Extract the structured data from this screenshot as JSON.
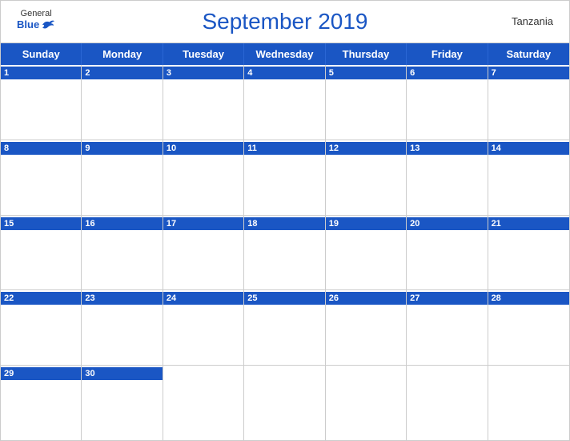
{
  "header": {
    "title": "September 2019",
    "country": "Tanzania",
    "logo": {
      "general": "General",
      "blue": "Blue"
    }
  },
  "days_of_week": [
    "Sunday",
    "Monday",
    "Tuesday",
    "Wednesday",
    "Thursday",
    "Friday",
    "Saturday"
  ],
  "weeks": [
    [
      1,
      2,
      3,
      4,
      5,
      6,
      7
    ],
    [
      8,
      9,
      10,
      11,
      12,
      13,
      14
    ],
    [
      15,
      16,
      17,
      18,
      19,
      20,
      21
    ],
    [
      22,
      23,
      24,
      25,
      26,
      27,
      28
    ],
    [
      29,
      30,
      null,
      null,
      null,
      null,
      null
    ]
  ],
  "colors": {
    "header_blue": "#1a56c4",
    "white": "#ffffff",
    "border": "#cccccc"
  }
}
